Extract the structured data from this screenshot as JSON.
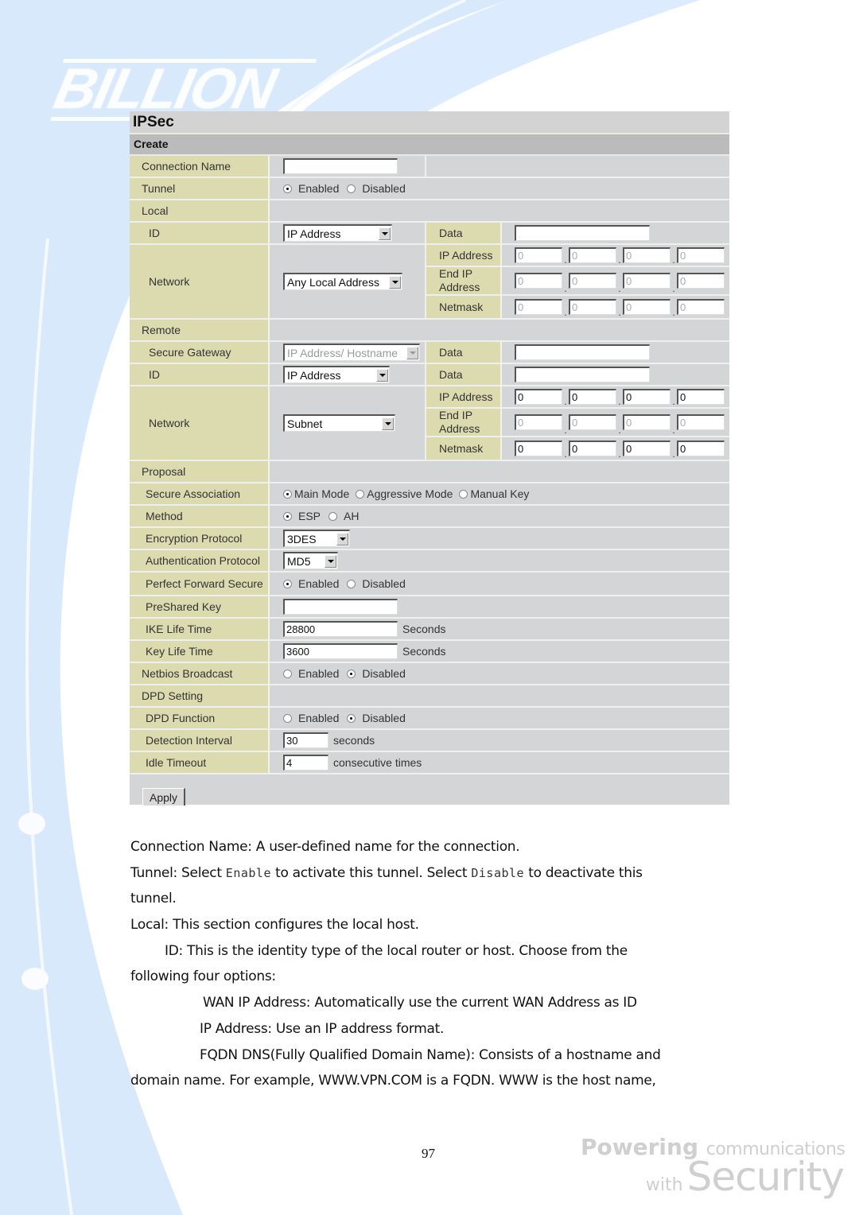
{
  "brand": {
    "logo_text": "BILLION",
    "tagline_bold": "Powering",
    "tagline_rest": "communications",
    "tagline_with": "with",
    "tagline_security": "Security"
  },
  "panel": {
    "title": "IPSec",
    "section": "Create",
    "connection_name": {
      "label": "Connection Name",
      "value": ""
    },
    "tunnel": {
      "label": "Tunnel",
      "options": [
        "Enabled",
        "Disabled"
      ],
      "selected": "Enabled"
    },
    "local": {
      "label": "Local",
      "id": {
        "label": "ID",
        "selected": "IP Address",
        "data_label": "Data",
        "data_value": ""
      },
      "network": {
        "label": "Network",
        "selected": "Any Local Address",
        "ip_address": {
          "label": "IP Address",
          "octets": [
            "0",
            "0",
            "0",
            "0"
          ]
        },
        "end_ip_address": {
          "label": "End IP Address",
          "label_line1": "End IP",
          "label_line2": "Address",
          "octets": [
            "0",
            "0",
            "0",
            "0"
          ]
        },
        "netmask": {
          "label": "Netmask",
          "octets": [
            "0",
            "0",
            "0",
            "0"
          ]
        }
      }
    },
    "remote": {
      "label": "Remote",
      "secure_gateway": {
        "label": "Secure Gateway",
        "selected": "IP Address/ Hostname",
        "data_label": "Data",
        "data_value": ""
      },
      "id": {
        "label": "ID",
        "selected": "IP Address",
        "data_label": "Data",
        "data_value": ""
      },
      "network": {
        "label": "Network",
        "selected": "Subnet",
        "ip_address": {
          "label": "IP Address",
          "octets": [
            "0",
            "0",
            "0",
            "0"
          ]
        },
        "end_ip_address": {
          "label": "End IP Address",
          "label_line1": "End IP",
          "label_line2": "Address",
          "octets": [
            "0",
            "0",
            "0",
            "0"
          ]
        },
        "netmask": {
          "label": "Netmask",
          "octets": [
            "0",
            "0",
            "0",
            "0"
          ]
        }
      }
    },
    "proposal": {
      "label": "Proposal",
      "secure_association": {
        "label": "Secure Association",
        "options": [
          "Main Mode",
          "Aggressive Mode",
          "Manual Key"
        ],
        "selected": "Main Mode"
      },
      "method": {
        "label": "Method",
        "options": [
          "ESP",
          "AH"
        ],
        "selected": "ESP"
      },
      "encryption": {
        "label": "Encryption Protocol",
        "selected": "3DES"
      },
      "authentication": {
        "label": "Authentication Protocol",
        "selected": "MD5"
      },
      "pfs": {
        "label": "Perfect Forward Secure",
        "options": [
          "Enabled",
          "Disabled"
        ],
        "selected": "Enabled"
      },
      "preshared_key": {
        "label": "PreShared Key",
        "value": ""
      },
      "ike_life_time": {
        "label": "IKE Life Time",
        "value": "28800",
        "unit": "Seconds"
      },
      "key_life_time": {
        "label": "Key Life Time",
        "value": "3600",
        "unit": "Seconds"
      }
    },
    "netbios": {
      "label": "Netbios Broadcast",
      "options": [
        "Enabled",
        "Disabled"
      ],
      "selected": "Disabled"
    },
    "dpd": {
      "label": "DPD Setting",
      "function": {
        "label": "DPD Function",
        "options": [
          "Enabled",
          "Disabled"
        ],
        "selected": "Disabled"
      },
      "interval": {
        "label": "Detection Interval",
        "value": "30",
        "unit": "seconds"
      },
      "idle": {
        "label": "Idle Timeout",
        "value": "4",
        "unit": "consecutive times"
      }
    },
    "apply_label": "Apply"
  },
  "doc": {
    "p1": "Connection Name: A user-defined name for the connection.",
    "p2a": "Tunnel: Select ",
    "p2_enable": "Enable",
    "p2b": " to activate this tunnel. Select ",
    "p2_disable": "Disable",
    "p2c": " to deactivate this",
    "p3": "tunnel.",
    "p4": "Local: This section configures the local host.",
    "p5": "ID: This is the identity type of the local router or host. Choose from the",
    "p6": "following four options:",
    "p7": "WAN IP Address: Automatically use the current WAN Address as ID",
    "p8": "IP Address: Use an IP address format.",
    "p9": "FQDN DNS(Fully Qualified Domain Name): Consists of a hostname and",
    "p10": "domain name. For example, WWW.VPN.COM is a FQDN. WWW is the host name,"
  },
  "page_number": "97"
}
